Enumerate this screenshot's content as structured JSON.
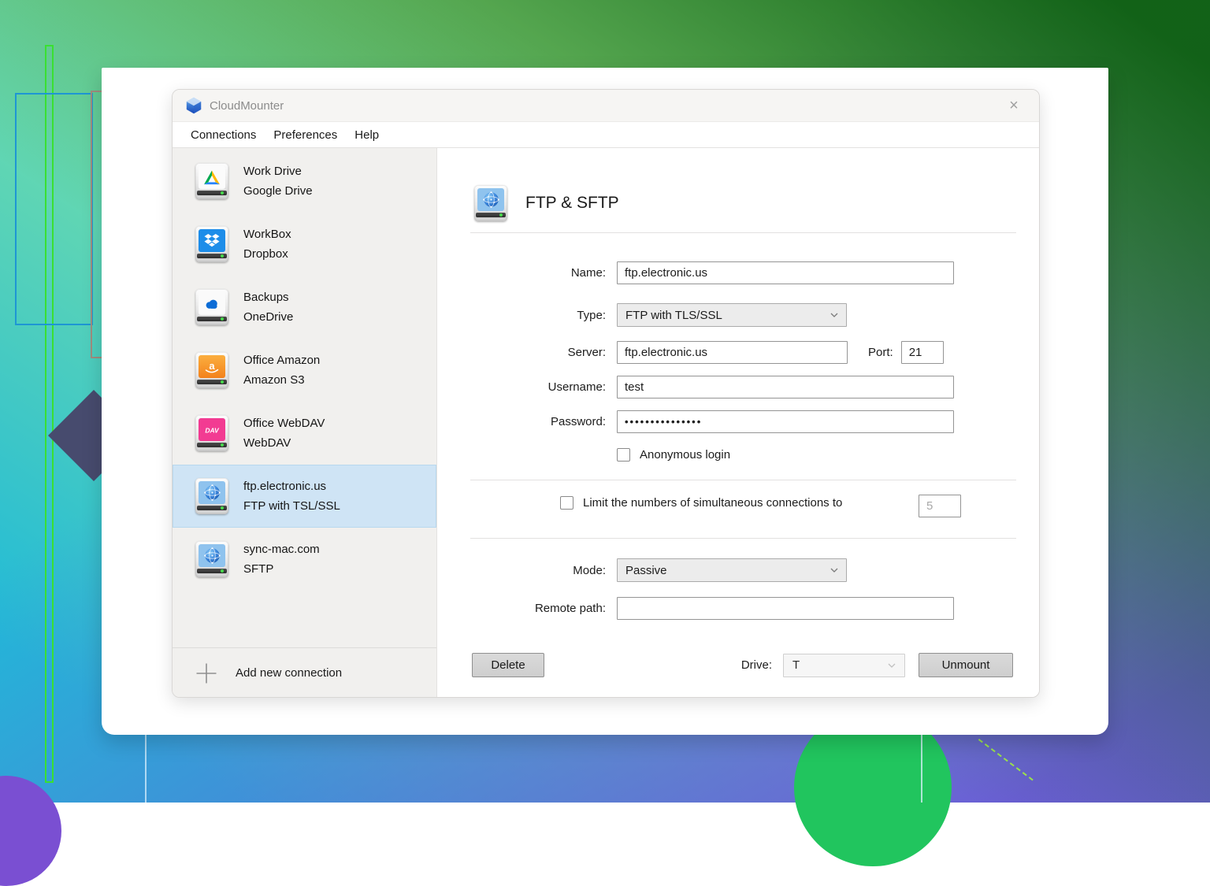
{
  "window": {
    "app_title": "CloudMounter",
    "close_glyph": "×"
  },
  "menu": {
    "items": [
      "Connections",
      "Preferences",
      "Help"
    ]
  },
  "sidebar": {
    "items": [
      {
        "icon": "google-drive-icon",
        "title": "Work Drive",
        "subtitle": "Google Drive",
        "selected": false
      },
      {
        "icon": "dropbox-icon",
        "title": "WorkBox",
        "subtitle": "Dropbox",
        "selected": false
      },
      {
        "icon": "onedrive-icon",
        "title": "Backups",
        "subtitle": "OneDrive",
        "selected": false
      },
      {
        "icon": "amazon-s3-icon",
        "title": "Office Amazon",
        "subtitle": "Amazon S3",
        "selected": false
      },
      {
        "icon": "webdav-icon",
        "title": "Office WebDAV",
        "subtitle": "WebDAV",
        "selected": false
      },
      {
        "icon": "ftp-globe-icon",
        "title": "ftp.electronic.us",
        "subtitle": "FTP with TSL/SSL",
        "selected": true
      },
      {
        "icon": "ftp-globe-icon",
        "title": "sync-mac.com",
        "subtitle": "SFTP",
        "selected": false
      }
    ],
    "add_new_label": "Add new connection"
  },
  "main": {
    "header_title": "FTP & SFTP",
    "form": {
      "name_label": "Name:",
      "name_value": "ftp.electronic.us",
      "type_label": "Type:",
      "type_value": "FTP with TLS/SSL",
      "server_label": "Server:",
      "server_value": "ftp.electronic.us",
      "port_label": "Port:",
      "port_value": "21",
      "username_label": "Username:",
      "username_value": "test",
      "password_label": "Password:",
      "password_value": "•••••••••••••••",
      "anonymous_label": "Anonymous login",
      "anonymous_checked": false,
      "limit_label": "Limit the numbers of simultaneous connections to",
      "limit_value": "5",
      "limit_checked": false,
      "mode_label": "Mode:",
      "mode_value": "Passive",
      "remote_path_label": "Remote path:",
      "remote_path_value": ""
    },
    "footer": {
      "delete_label": "Delete",
      "drive_label": "Drive:",
      "drive_value": "T",
      "unmount_label": "Unmount"
    }
  },
  "colors": {
    "selection_bg": "#cfe4f5",
    "bg_top_left": "#9ff18f",
    "bg_top_right": "#0b5c10",
    "bg_bottom_left": "#12b4e0",
    "bg_bottom_right": "#6b57d8",
    "accent_circle_green": "#21c55e",
    "accent_circle_purple": "#7a4fd2",
    "diamond_navy": "#474b6e",
    "outline_green": "#3ae031",
    "outline_blue": "#1e96d4",
    "led_green": "#46d84b"
  }
}
